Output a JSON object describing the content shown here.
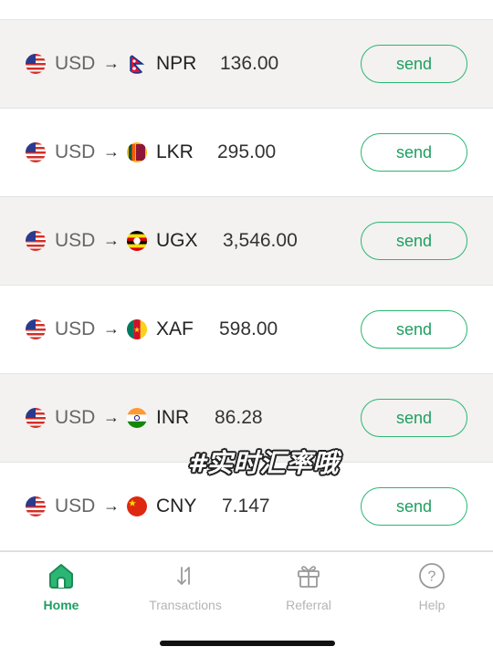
{
  "rates": [
    {
      "from_code": "USD",
      "arrow": "→",
      "to_code": "NPR",
      "rate": "136.00",
      "send_label": "send",
      "to_flag": "nepal-flag-icon"
    },
    {
      "from_code": "USD",
      "arrow": "→",
      "to_code": "LKR",
      "rate": "295.00",
      "send_label": "send",
      "to_flag": "sri-lanka-flag-icon"
    },
    {
      "from_code": "USD",
      "arrow": "→",
      "to_code": "UGX",
      "rate": "3,546.00",
      "send_label": "send",
      "to_flag": "uganda-flag-icon"
    },
    {
      "from_code": "USD",
      "arrow": "→",
      "to_code": "XAF",
      "rate": "598.00",
      "send_label": "send",
      "to_flag": "cameroon-flag-icon"
    },
    {
      "from_code": "USD",
      "arrow": "→",
      "to_code": "INR",
      "rate": "86.28",
      "send_label": "send",
      "to_flag": "india-flag-icon"
    },
    {
      "from_code": "USD",
      "arrow": "→",
      "to_code": "CNY",
      "rate": "7.147",
      "send_label": "send",
      "to_flag": "china-flag-icon"
    }
  ],
  "overlay": {
    "tag": "#实时汇率哦"
  },
  "tabbar": {
    "tabs": [
      {
        "label": "Home",
        "icon": "home-icon",
        "active": true
      },
      {
        "label": "Transactions",
        "icon": "transactions-icon",
        "active": false
      },
      {
        "label": "Referral",
        "icon": "gift-icon",
        "active": false
      },
      {
        "label": "Help",
        "icon": "help-icon",
        "active": false
      }
    ]
  },
  "colors": {
    "accent": "#2bb673",
    "row_shaded": "#f3f2f0",
    "inactive_tab": "#b4b4b4"
  }
}
